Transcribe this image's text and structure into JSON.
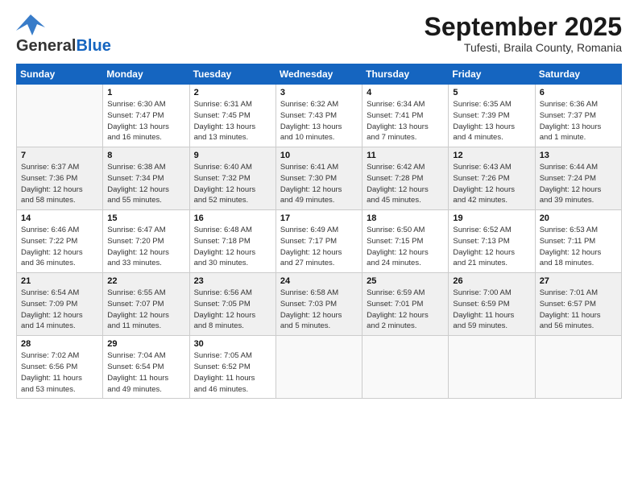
{
  "logo": {
    "general": "General",
    "blue": "Blue"
  },
  "title": "September 2025",
  "subtitle": "Tufesti, Braila County, Romania",
  "days_of_week": [
    "Sunday",
    "Monday",
    "Tuesday",
    "Wednesday",
    "Thursday",
    "Friday",
    "Saturday"
  ],
  "weeks": [
    [
      {
        "day": "",
        "info": ""
      },
      {
        "day": "1",
        "info": "Sunrise: 6:30 AM\nSunset: 7:47 PM\nDaylight: 13 hours\nand 16 minutes."
      },
      {
        "day": "2",
        "info": "Sunrise: 6:31 AM\nSunset: 7:45 PM\nDaylight: 13 hours\nand 13 minutes."
      },
      {
        "day": "3",
        "info": "Sunrise: 6:32 AM\nSunset: 7:43 PM\nDaylight: 13 hours\nand 10 minutes."
      },
      {
        "day": "4",
        "info": "Sunrise: 6:34 AM\nSunset: 7:41 PM\nDaylight: 13 hours\nand 7 minutes."
      },
      {
        "day": "5",
        "info": "Sunrise: 6:35 AM\nSunset: 7:39 PM\nDaylight: 13 hours\nand 4 minutes."
      },
      {
        "day": "6",
        "info": "Sunrise: 6:36 AM\nSunset: 7:37 PM\nDaylight: 13 hours\nand 1 minute."
      }
    ],
    [
      {
        "day": "7",
        "info": "Sunrise: 6:37 AM\nSunset: 7:36 PM\nDaylight: 12 hours\nand 58 minutes."
      },
      {
        "day": "8",
        "info": "Sunrise: 6:38 AM\nSunset: 7:34 PM\nDaylight: 12 hours\nand 55 minutes."
      },
      {
        "day": "9",
        "info": "Sunrise: 6:40 AM\nSunset: 7:32 PM\nDaylight: 12 hours\nand 52 minutes."
      },
      {
        "day": "10",
        "info": "Sunrise: 6:41 AM\nSunset: 7:30 PM\nDaylight: 12 hours\nand 49 minutes."
      },
      {
        "day": "11",
        "info": "Sunrise: 6:42 AM\nSunset: 7:28 PM\nDaylight: 12 hours\nand 45 minutes."
      },
      {
        "day": "12",
        "info": "Sunrise: 6:43 AM\nSunset: 7:26 PM\nDaylight: 12 hours\nand 42 minutes."
      },
      {
        "day": "13",
        "info": "Sunrise: 6:44 AM\nSunset: 7:24 PM\nDaylight: 12 hours\nand 39 minutes."
      }
    ],
    [
      {
        "day": "14",
        "info": "Sunrise: 6:46 AM\nSunset: 7:22 PM\nDaylight: 12 hours\nand 36 minutes."
      },
      {
        "day": "15",
        "info": "Sunrise: 6:47 AM\nSunset: 7:20 PM\nDaylight: 12 hours\nand 33 minutes."
      },
      {
        "day": "16",
        "info": "Sunrise: 6:48 AM\nSunset: 7:18 PM\nDaylight: 12 hours\nand 30 minutes."
      },
      {
        "day": "17",
        "info": "Sunrise: 6:49 AM\nSunset: 7:17 PM\nDaylight: 12 hours\nand 27 minutes."
      },
      {
        "day": "18",
        "info": "Sunrise: 6:50 AM\nSunset: 7:15 PM\nDaylight: 12 hours\nand 24 minutes."
      },
      {
        "day": "19",
        "info": "Sunrise: 6:52 AM\nSunset: 7:13 PM\nDaylight: 12 hours\nand 21 minutes."
      },
      {
        "day": "20",
        "info": "Sunrise: 6:53 AM\nSunset: 7:11 PM\nDaylight: 12 hours\nand 18 minutes."
      }
    ],
    [
      {
        "day": "21",
        "info": "Sunrise: 6:54 AM\nSunset: 7:09 PM\nDaylight: 12 hours\nand 14 minutes."
      },
      {
        "day": "22",
        "info": "Sunrise: 6:55 AM\nSunset: 7:07 PM\nDaylight: 12 hours\nand 11 minutes."
      },
      {
        "day": "23",
        "info": "Sunrise: 6:56 AM\nSunset: 7:05 PM\nDaylight: 12 hours\nand 8 minutes."
      },
      {
        "day": "24",
        "info": "Sunrise: 6:58 AM\nSunset: 7:03 PM\nDaylight: 12 hours\nand 5 minutes."
      },
      {
        "day": "25",
        "info": "Sunrise: 6:59 AM\nSunset: 7:01 PM\nDaylight: 12 hours\nand 2 minutes."
      },
      {
        "day": "26",
        "info": "Sunrise: 7:00 AM\nSunset: 6:59 PM\nDaylight: 11 hours\nand 59 minutes."
      },
      {
        "day": "27",
        "info": "Sunrise: 7:01 AM\nSunset: 6:57 PM\nDaylight: 11 hours\nand 56 minutes."
      }
    ],
    [
      {
        "day": "28",
        "info": "Sunrise: 7:02 AM\nSunset: 6:56 PM\nDaylight: 11 hours\nand 53 minutes."
      },
      {
        "day": "29",
        "info": "Sunrise: 7:04 AM\nSunset: 6:54 PM\nDaylight: 11 hours\nand 49 minutes."
      },
      {
        "day": "30",
        "info": "Sunrise: 7:05 AM\nSunset: 6:52 PM\nDaylight: 11 hours\nand 46 minutes."
      },
      {
        "day": "",
        "info": ""
      },
      {
        "day": "",
        "info": ""
      },
      {
        "day": "",
        "info": ""
      },
      {
        "day": "",
        "info": ""
      }
    ]
  ]
}
